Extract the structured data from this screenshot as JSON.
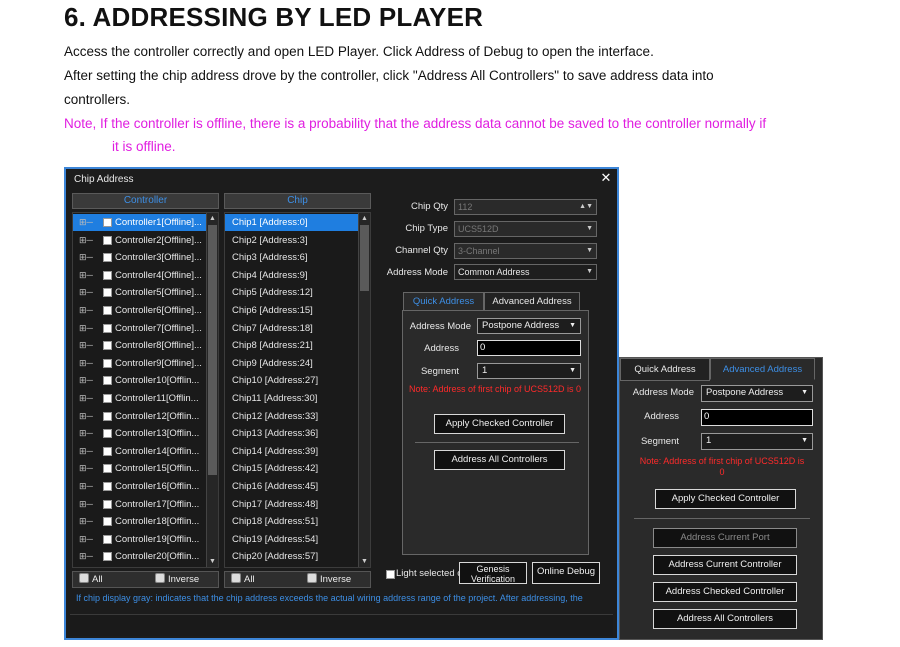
{
  "doc": {
    "title": "6. ADDRESSING BY LED PLAYER",
    "p1": "Access the controller correctly and open LED Player. Click Address of Debug to open the interface.",
    "p2a": "After setting the chip address drove by the controller, click \"Address All Controllers\" to save address data into",
    "p2b": "controllers.",
    "note_a": "Note, If the controller is offline, there is a probability that the address data cannot be saved to the controller normally if",
    "note_b": "it is offline."
  },
  "dialog": {
    "title": "Chip Address",
    "close_icon": "close-icon",
    "controller_header": "Controller",
    "chip_header": "Chip",
    "controllers": [
      "Controller1[Offline]...",
      "Controller2[Offline]...",
      "Controller3[Offline]...",
      "Controller4[Offline]...",
      "Controller5[Offline]...",
      "Controller6[Offline]...",
      "Controller7[Offline]...",
      "Controller8[Offline]...",
      "Controller9[Offline]...",
      "Controller10[Offlin...",
      "Controller11[Offlin...",
      "Controller12[Offlin...",
      "Controller13[Offlin...",
      "Controller14[Offlin...",
      "Controller15[Offlin...",
      "Controller16[Offlin...",
      "Controller17[Offlin...",
      "Controller18[Offlin...",
      "Controller19[Offlin...",
      "Controller20[Offlin..."
    ],
    "chips": [
      "Chip1 [Address:0]",
      "Chip2 [Address:3]",
      "Chip3 [Address:6]",
      "Chip4 [Address:9]",
      "Chip5 [Address:12]",
      "Chip6 [Address:15]",
      "Chip7 [Address:18]",
      "Chip8 [Address:21]",
      "Chip9 [Address:24]",
      "Chip10 [Address:27]",
      "Chip11 [Address:30]",
      "Chip12 [Address:33]",
      "Chip13 [Address:36]",
      "Chip14 [Address:39]",
      "Chip15 [Address:42]",
      "Chip16 [Address:45]",
      "Chip17 [Address:48]",
      "Chip18 [Address:51]",
      "Chip19 [Address:54]",
      "Chip20 [Address:57]"
    ],
    "all_label": "All",
    "inverse_label": "Inverse",
    "chip_qty_label": "Chip Qty",
    "chip_qty_value": "112",
    "chip_type_label": "Chip Type",
    "chip_type_value": "UCS512D",
    "channel_qty_label": "Channel Qty",
    "channel_qty_value": "3-Channel",
    "address_mode_label": "Address Mode",
    "address_mode_value": "Common Address",
    "tab_quick": "Quick Address",
    "tab_advanced": "Advanced Address",
    "q_address_mode_label": "Address Mode",
    "q_address_mode_value": "Postpone Address",
    "q_address_label": "Address",
    "q_address_value": "0",
    "q_segment_label": "Segment",
    "q_segment_value": "1",
    "q_note": "Note: Address of first chip of UCS512D is 0",
    "apply_checked": "Apply Checked Controller",
    "address_all": "Address All Controllers",
    "light_selected": "Light selected c",
    "genesis_a": "Genesis",
    "genesis_b": "Verification",
    "online_debug": "Online Debug",
    "footer": "If chip display gray: indicates that the chip address exceeds the actual wiring address range of the project. After addressing, the"
  },
  "panel": {
    "tab_quick": "Quick Address",
    "tab_advanced": "Advanced Address",
    "address_mode_label": "Address Mode",
    "address_mode_value": "Postpone Address",
    "address_label": "Address",
    "address_value": "0",
    "segment_label": "Segment",
    "segment_value": "1",
    "note_a": "Note: Address of first chip of UCS512D is",
    "note_b": "0",
    "apply_checked": "Apply Checked Controller",
    "address_current_port": "Address Current Port",
    "address_current_controller": "Address Current Controller",
    "address_checked_controller": "Address Checked Controller",
    "address_all_controllers": "Address All Controllers"
  },
  "colors": {
    "accent": "#3d8fe6",
    "selected": "#1f7ee0",
    "warning": "#ff2a2a",
    "note": "#e01ee0"
  }
}
